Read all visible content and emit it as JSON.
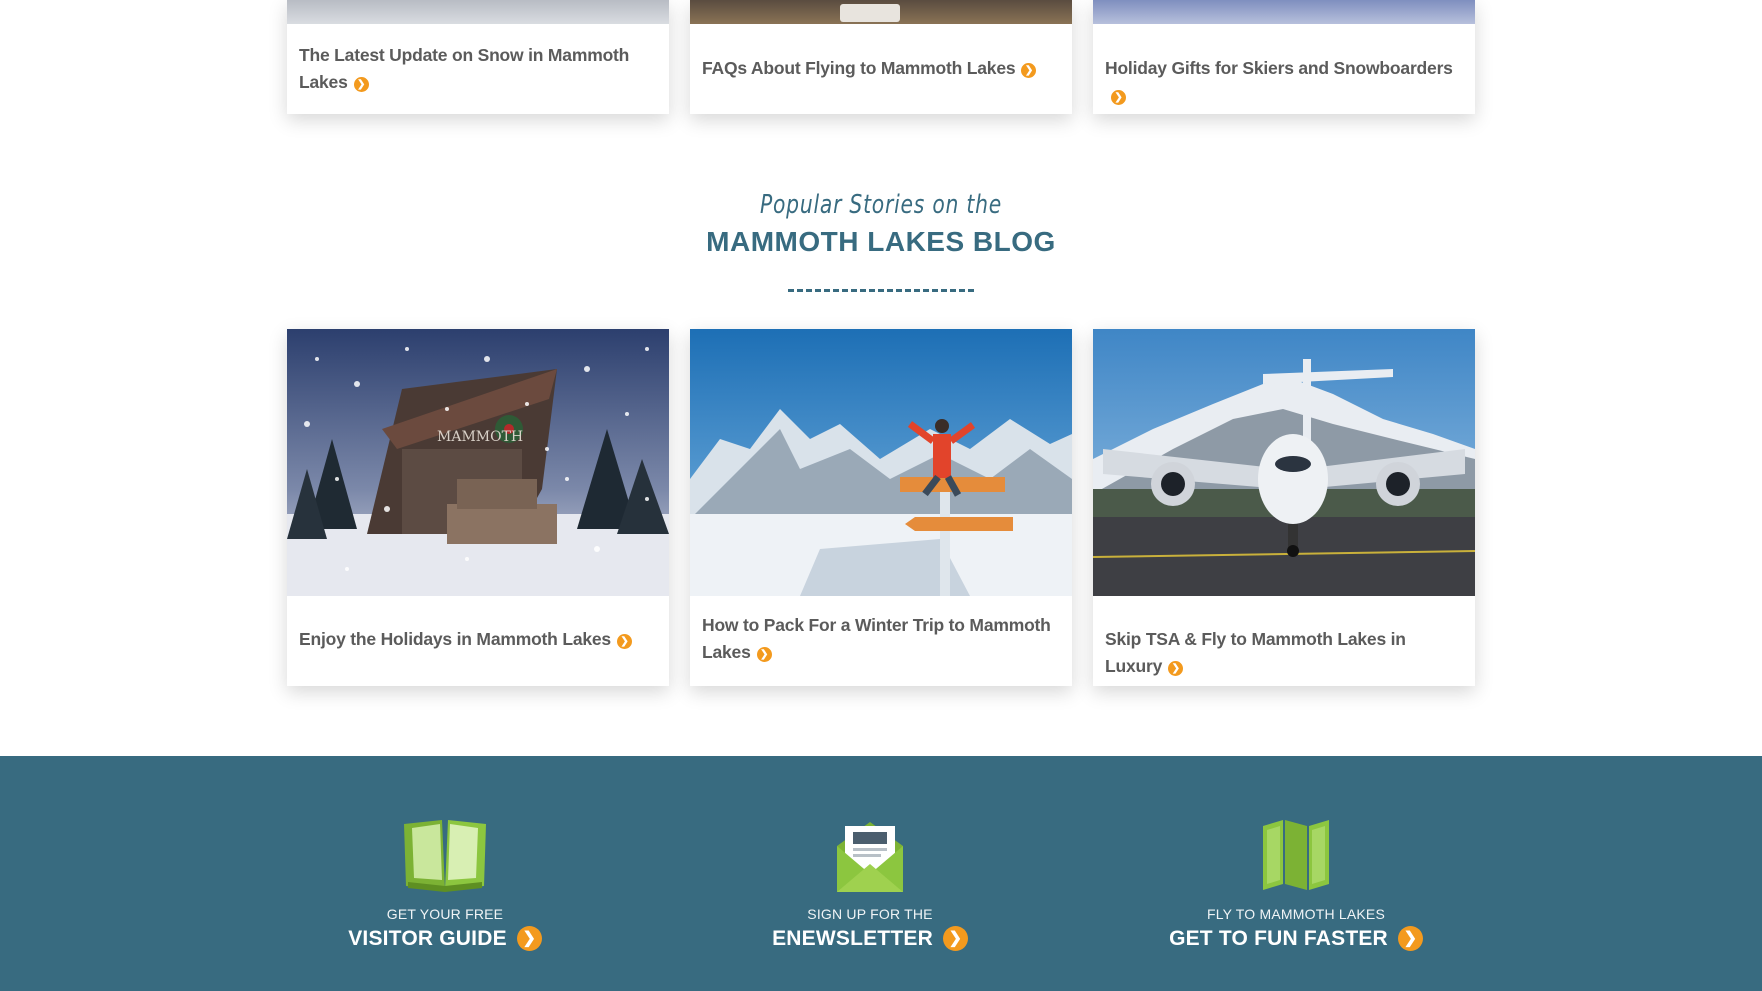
{
  "top_cards": [
    {
      "title": "The Latest Update on Snow in Mammoth Lakes"
    },
    {
      "title": "FAQs About Flying to Mammoth Lakes"
    },
    {
      "title": "Holiday Gifts for Skiers and Snowboarders"
    }
  ],
  "blog_section": {
    "script_heading": "Popular Stories on the",
    "main_heading": "MAMMOTH LAKES BLOG"
  },
  "popular_cards": [
    {
      "title": "Enjoy the Holidays in Mammoth Lakes",
      "image": "snowy-mammoth-lakes-sign-photo"
    },
    {
      "title": "How to Pack For a Winter Trip to Mammoth Lakes",
      "image": "skier-on-signpost-photo"
    },
    {
      "title": "Skip TSA & Fly to Mammoth Lakes in Luxury",
      "image": "private-jet-photo"
    }
  ],
  "footer": {
    "ctas": [
      {
        "small": "GET YOUR FREE",
        "big": "VISITOR GUIDE",
        "icon": "book-icon"
      },
      {
        "small": "SIGN UP FOR THE",
        "big": "ENEWSLETTER",
        "icon": "envelope-icon"
      },
      {
        "small": "FLY TO MAMMOTH LAKES",
        "big": "GET TO FUN FASTER",
        "icon": "map-icon"
      }
    ],
    "colors": {
      "background": "#386b80",
      "accent": "#f39a1e",
      "icon_green": "#8cc63f"
    }
  }
}
